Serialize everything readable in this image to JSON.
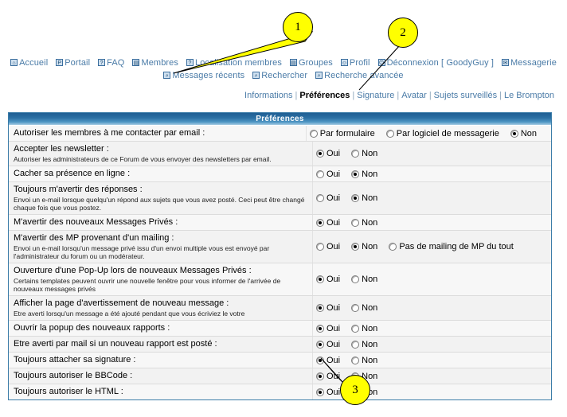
{
  "nav": {
    "row1": [
      {
        "icon": "home-icon",
        "glyph": "⌂",
        "label": "Accueil"
      },
      {
        "icon": "portal-icon",
        "glyph": "P",
        "label": "Portail"
      },
      {
        "icon": "faq-icon",
        "glyph": "?",
        "label": "FAQ"
      },
      {
        "icon": "members-icon",
        "glyph": "▤",
        "label": "Membres"
      },
      {
        "icon": "member-locate-icon",
        "glyph": "?",
        "label": "Localisation membres"
      },
      {
        "icon": "groups-icon",
        "glyph": "▤",
        "label": "Groupes"
      },
      {
        "icon": "profile-icon",
        "glyph": "☺",
        "label": "Profil"
      },
      {
        "icon": "logout-icon",
        "glyph": "⏻",
        "label": "Déconnexion [ GoodyGuy ]"
      },
      {
        "icon": "messaging-icon",
        "glyph": "✉",
        "label": "Messagerie"
      }
    ],
    "row2": [
      {
        "icon": "recent-messages-icon",
        "glyph": "⌕",
        "label": "Messages récents"
      },
      {
        "icon": "search-icon",
        "glyph": "⌕",
        "label": "Rechercher"
      },
      {
        "icon": "advanced-search-icon",
        "glyph": "⌕",
        "label": "Recherche avancée"
      }
    ]
  },
  "subnav": {
    "items": [
      {
        "label": "Informations",
        "current": false
      },
      {
        "label": "Préférences",
        "current": true
      },
      {
        "label": "Signature",
        "current": false
      },
      {
        "label": "Avatar",
        "current": false
      },
      {
        "label": "Sujets surveillés",
        "current": false
      },
      {
        "label": "Le Brompton",
        "current": false
      }
    ],
    "separator": "|"
  },
  "table": {
    "header": "Préférences",
    "rows": [
      {
        "title": "Autoriser les membres à me contacter par email :",
        "desc": "",
        "options": [
          {
            "label": "Par formulaire",
            "selected": false
          },
          {
            "label": "Par logiciel de messagerie",
            "selected": false
          },
          {
            "label": "Non",
            "selected": true
          }
        ]
      },
      {
        "title": "Accepter les newsletter :",
        "desc": "Autoriser les administrateurs de ce Forum de vous envoyer des newsletters par email.",
        "options": [
          {
            "label": "Oui",
            "selected": true
          },
          {
            "label": "Non",
            "selected": false
          }
        ]
      },
      {
        "title": "Cacher sa présence en ligne :",
        "desc": "",
        "options": [
          {
            "label": "Oui",
            "selected": false
          },
          {
            "label": "Non",
            "selected": true
          }
        ]
      },
      {
        "title": "Toujours m'avertir des réponses :",
        "desc": "Envoi un e-mail lorsque quelqu'un répond aux sujets que vous avez posté. Ceci peut être changé chaque fois que vous postez.",
        "options": [
          {
            "label": "Oui",
            "selected": false
          },
          {
            "label": "Non",
            "selected": true
          }
        ]
      },
      {
        "title": "M'avertir des nouveaux Messages Privés :",
        "desc": "",
        "options": [
          {
            "label": "Oui",
            "selected": true
          },
          {
            "label": "Non",
            "selected": false
          }
        ]
      },
      {
        "title": "M'avertir des MP provenant d'un mailing :",
        "desc": "Envoi un e-mail lorsqu'un message privé issu d'un envoi multiple vous est envoyé par l'administrateur du forum ou un modérateur.",
        "options": [
          {
            "label": "Oui",
            "selected": false
          },
          {
            "label": "Non",
            "selected": true
          },
          {
            "label": "Pas de mailing de MP du tout",
            "selected": false
          }
        ]
      },
      {
        "title": "Ouverture d'une Pop-Up lors de nouveaux Messages Privés :",
        "desc": "Certains templates peuvent ouvrir une nouvelle fenêtre pour vous informer de l'arrivée de nouveaux messages privés",
        "options": [
          {
            "label": "Oui",
            "selected": true
          },
          {
            "label": "Non",
            "selected": false
          }
        ]
      },
      {
        "title": "Afficher la page d'avertissement de nouveau message :",
        "desc": "Etre averti lorsqu'un message a été ajouté pendant que vous écriviez le votre",
        "options": [
          {
            "label": "Oui",
            "selected": true
          },
          {
            "label": "Non",
            "selected": false
          }
        ]
      },
      {
        "title": "Ouvrir la popup des nouveaux rapports :",
        "desc": "",
        "options": [
          {
            "label": "Oui",
            "selected": true
          },
          {
            "label": "Non",
            "selected": false
          }
        ]
      },
      {
        "title": "Etre averti par mail si un nouveau rapport est posté :",
        "desc": "",
        "options": [
          {
            "label": "Oui",
            "selected": true
          },
          {
            "label": "Non",
            "selected": false
          }
        ]
      },
      {
        "title": "Toujours attacher sa signature :",
        "desc": "",
        "options": [
          {
            "label": "Oui",
            "selected": true
          },
          {
            "label": "Non",
            "selected": false
          }
        ]
      },
      {
        "title": "Toujours autoriser le BBCode :",
        "desc": "",
        "options": [
          {
            "label": "Oui",
            "selected": true
          },
          {
            "label": "Non",
            "selected": false
          }
        ]
      },
      {
        "title": "Toujours autoriser le HTML :",
        "desc": "",
        "options": [
          {
            "label": "Oui",
            "selected": true
          },
          {
            "label": "Non",
            "selected": false
          }
        ]
      }
    ]
  },
  "callouts": [
    {
      "number": "1"
    },
    {
      "number": "2"
    },
    {
      "number": "3"
    }
  ],
  "colors": {
    "link": "#4a7ba7",
    "header_blue": "#2b6fa3",
    "callout_fill": "#ffff00",
    "table_border": "#3b7ca8"
  }
}
